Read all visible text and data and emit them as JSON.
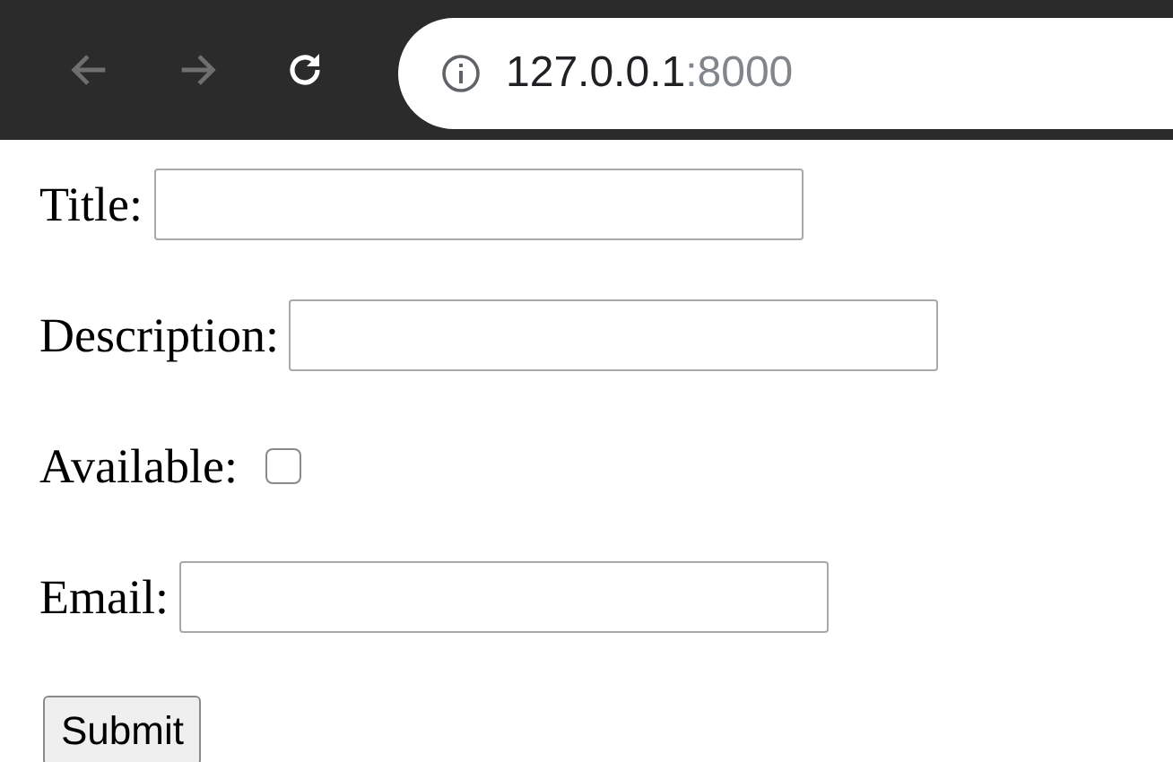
{
  "browser": {
    "back": {
      "disabled": true
    },
    "forward": {
      "disabled": true
    },
    "url_host": "127.0.0.1",
    "url_port": ":8000"
  },
  "form": {
    "fields": [
      {
        "kind": "text",
        "label": "Title:"
      },
      {
        "kind": "text",
        "label": "Description:"
      },
      {
        "kind": "checkbox",
        "label": "Available:",
        "checked": false
      },
      {
        "kind": "text",
        "label": "Email:"
      }
    ],
    "submit": "Submit"
  }
}
